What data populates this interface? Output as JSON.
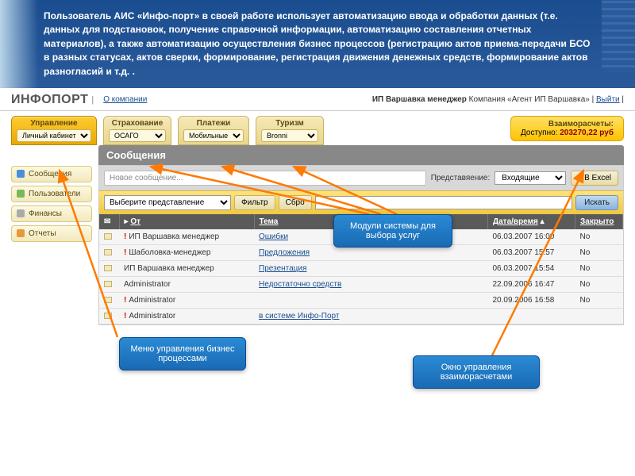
{
  "banner": "Пользователь АИС «Инфо-порт» в своей работе использует автоматизацию ввода и обработки данных (т.е. данных для подстановок, получение справочной информации, автоматизацию составления отчетных материалов), а также автоматизацию осуществления бизнес процессов (регистрацию актов приема-передачи БСО в разных статусах, актов сверки, формирование, регистрация движения денежных средств, формирование актов разногласий и т.д. .",
  "logo": "ИНФОПОРТ",
  "about": "О компании",
  "user_line_prefix": "ИП Варшавка менеджер",
  "user_line_company_label": "Компания",
  "user_line_company": "«Агент ИП Варшавка»",
  "logout": "Выйти",
  "tabs": [
    {
      "title": "Управление",
      "value": "Личный кабинет",
      "active": true
    },
    {
      "title": "Страхование",
      "value": "ОСАГО",
      "active": false
    },
    {
      "title": "Платежи",
      "value": "Мобильные",
      "active": false
    },
    {
      "title": "Туризм",
      "value": "Bronni",
      "active": false
    }
  ],
  "balance": {
    "title": "Взаиморасчеты:",
    "label": "Доступно:",
    "value": "203270,22 руб"
  },
  "sidebar": [
    {
      "label": "Сообщения",
      "cls": "s-blue"
    },
    {
      "label": "Пользователи",
      "cls": "s-green"
    },
    {
      "label": "Финансы",
      "cls": "s-gray"
    },
    {
      "label": "Отчеты",
      "cls": "s-orange"
    }
  ],
  "content_title": "Сообщения",
  "new_msg": "Новое сообщение...",
  "view_label": "Представяение:",
  "view_value": "Входящие",
  "excel_btn": "В Excel",
  "filter": {
    "select": "Выберите представление",
    "btn_filter": "Фильтр",
    "btn_reset": "Сбро",
    "btn_search": "Искать"
  },
  "cols": {
    "from": "От",
    "subject": "Тема",
    "date": "Дата/время",
    "closed": "Закрыто"
  },
  "rows": [
    {
      "flag": true,
      "from": "ИП Варшавка менеджер",
      "subject": "Ошибки",
      "date": "06.03.2007 16:00",
      "closed": "No"
    },
    {
      "flag": true,
      "from": "Шаболовка-менеджер",
      "subject": "Предложения",
      "date": "06.03.2007 15:57",
      "closed": "No"
    },
    {
      "flag": false,
      "from": "ИП Варшавка менеджер",
      "subject": "Презентация",
      "date": "06.03.2007 15:54",
      "closed": "No"
    },
    {
      "flag": false,
      "from": "Administrator",
      "subject": "Недостаточно средств",
      "date": "22.09.2006 16:47",
      "closed": "No"
    },
    {
      "flag": true,
      "from": "Administrator",
      "subject": "",
      "date": "20.09.2006 16:58",
      "closed": "No"
    },
    {
      "flag": true,
      "from": "Administrator",
      "subject": "в системе Инфо-Порт",
      "date": "",
      "closed": ""
    }
  ],
  "callouts": {
    "modules": "Модули системы для выбора услуг",
    "menu": "Меню управления бизнес процессами",
    "balance": "Окно управления взаиморасчетами"
  }
}
